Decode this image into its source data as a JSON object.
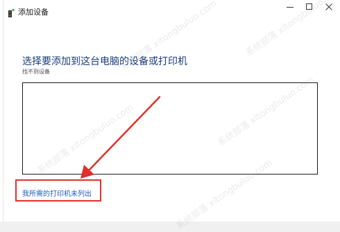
{
  "window": {
    "title": "添加设备",
    "controls": {
      "minimize_icon": "minimize-icon",
      "maximize_icon": "maximize-icon",
      "close_icon": "close-icon"
    }
  },
  "main": {
    "heading": "选择要添加到这台电脑的设备或打印机",
    "status": "找不到设备",
    "device_list": {
      "items": []
    },
    "printer_not_listed_link": "我所需的打印机未列出"
  },
  "annotation": {
    "highlight_color": "#e0302b",
    "arrow_color": "#e0302b"
  },
  "watermark": {
    "text": "系统部落 xitongbuluo.com"
  },
  "colors": {
    "heading": "#1a3c7a",
    "link": "#1f5fbf"
  }
}
